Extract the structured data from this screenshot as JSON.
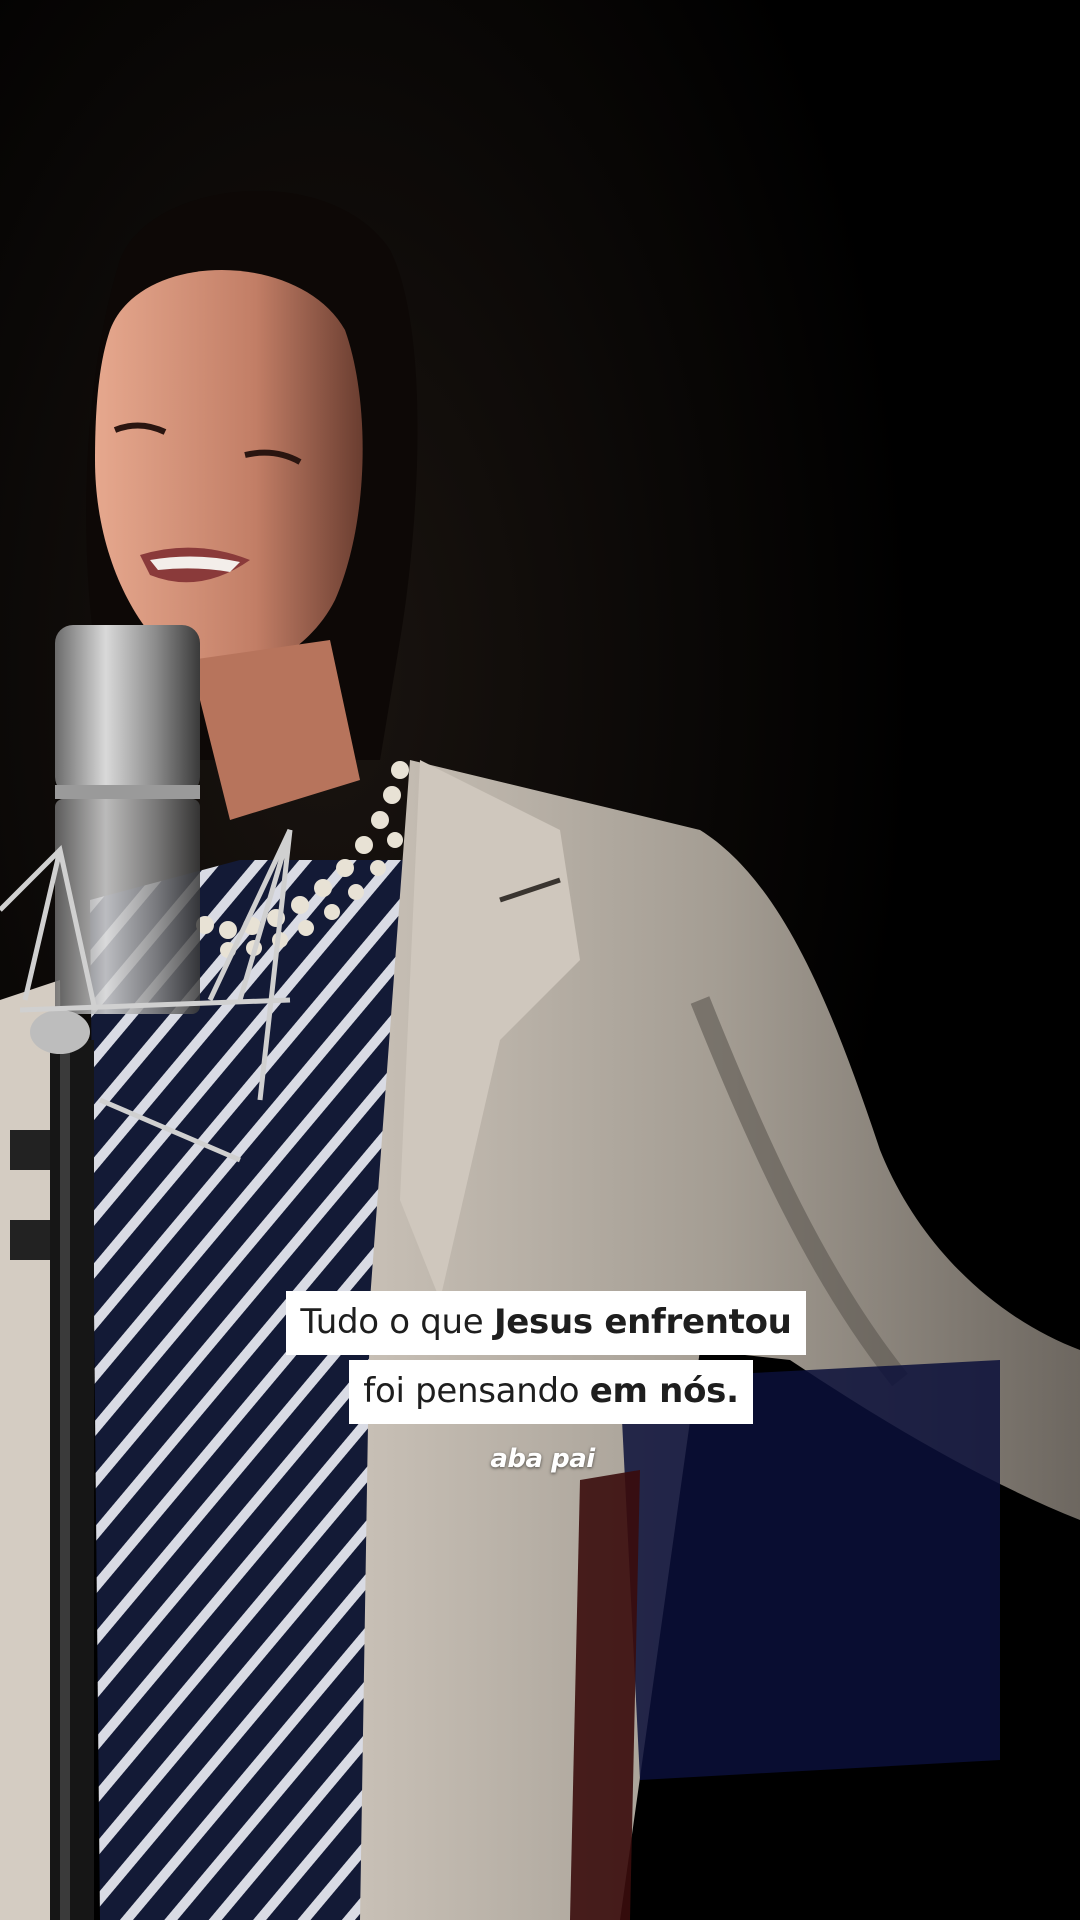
{
  "caption": {
    "line1_normal": "Tudo o que ",
    "line1_bold": "Jesus enfrentou",
    "line2_normal": "foi pensando ",
    "line2_bold": "em nós."
  },
  "watermark": "aba pai",
  "colors": {
    "background": "#000000",
    "caption_bg": "#ffffff",
    "caption_text": "#1e1e1e",
    "coat": "#a39c93",
    "dress": "#141a38"
  }
}
